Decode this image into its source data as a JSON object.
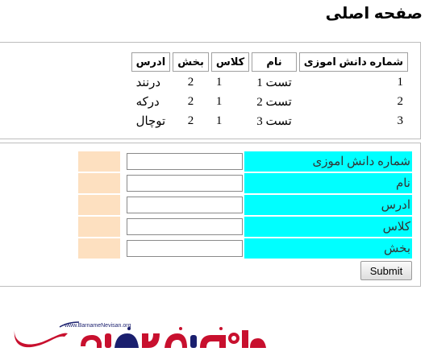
{
  "page": {
    "title": "صفحه اصلی"
  },
  "students_table": {
    "headers": [
      "شماره دانش اموزی",
      "نام",
      "کلاس",
      "بخش",
      "ادرس"
    ],
    "rows": [
      [
        "1",
        "تست 1",
        "1",
        "2",
        "درنند"
      ],
      [
        "2",
        "تست 2",
        "1",
        "2",
        "درکه"
      ],
      [
        "3",
        "تست 3",
        "1",
        "2",
        "توچال"
      ]
    ]
  },
  "form": {
    "fields": [
      {
        "label": "شماره دانش اموزی",
        "value": ""
      },
      {
        "label": "نام",
        "value": ""
      },
      {
        "label": "ادرس",
        "value": ""
      },
      {
        "label": "کلاس",
        "value": ""
      },
      {
        "label": "بخش",
        "value": ""
      }
    ],
    "submit_label": "Submit"
  },
  "logo": {
    "url_text": "www.BarnameNevisan.org",
    "brand_text": "برنامه نویسان",
    "color": "#c8102e",
    "accent": "#1a1f6e"
  },
  "colors": {
    "label_bg": "#00ffff",
    "extra_bg": "#fde0c0"
  }
}
